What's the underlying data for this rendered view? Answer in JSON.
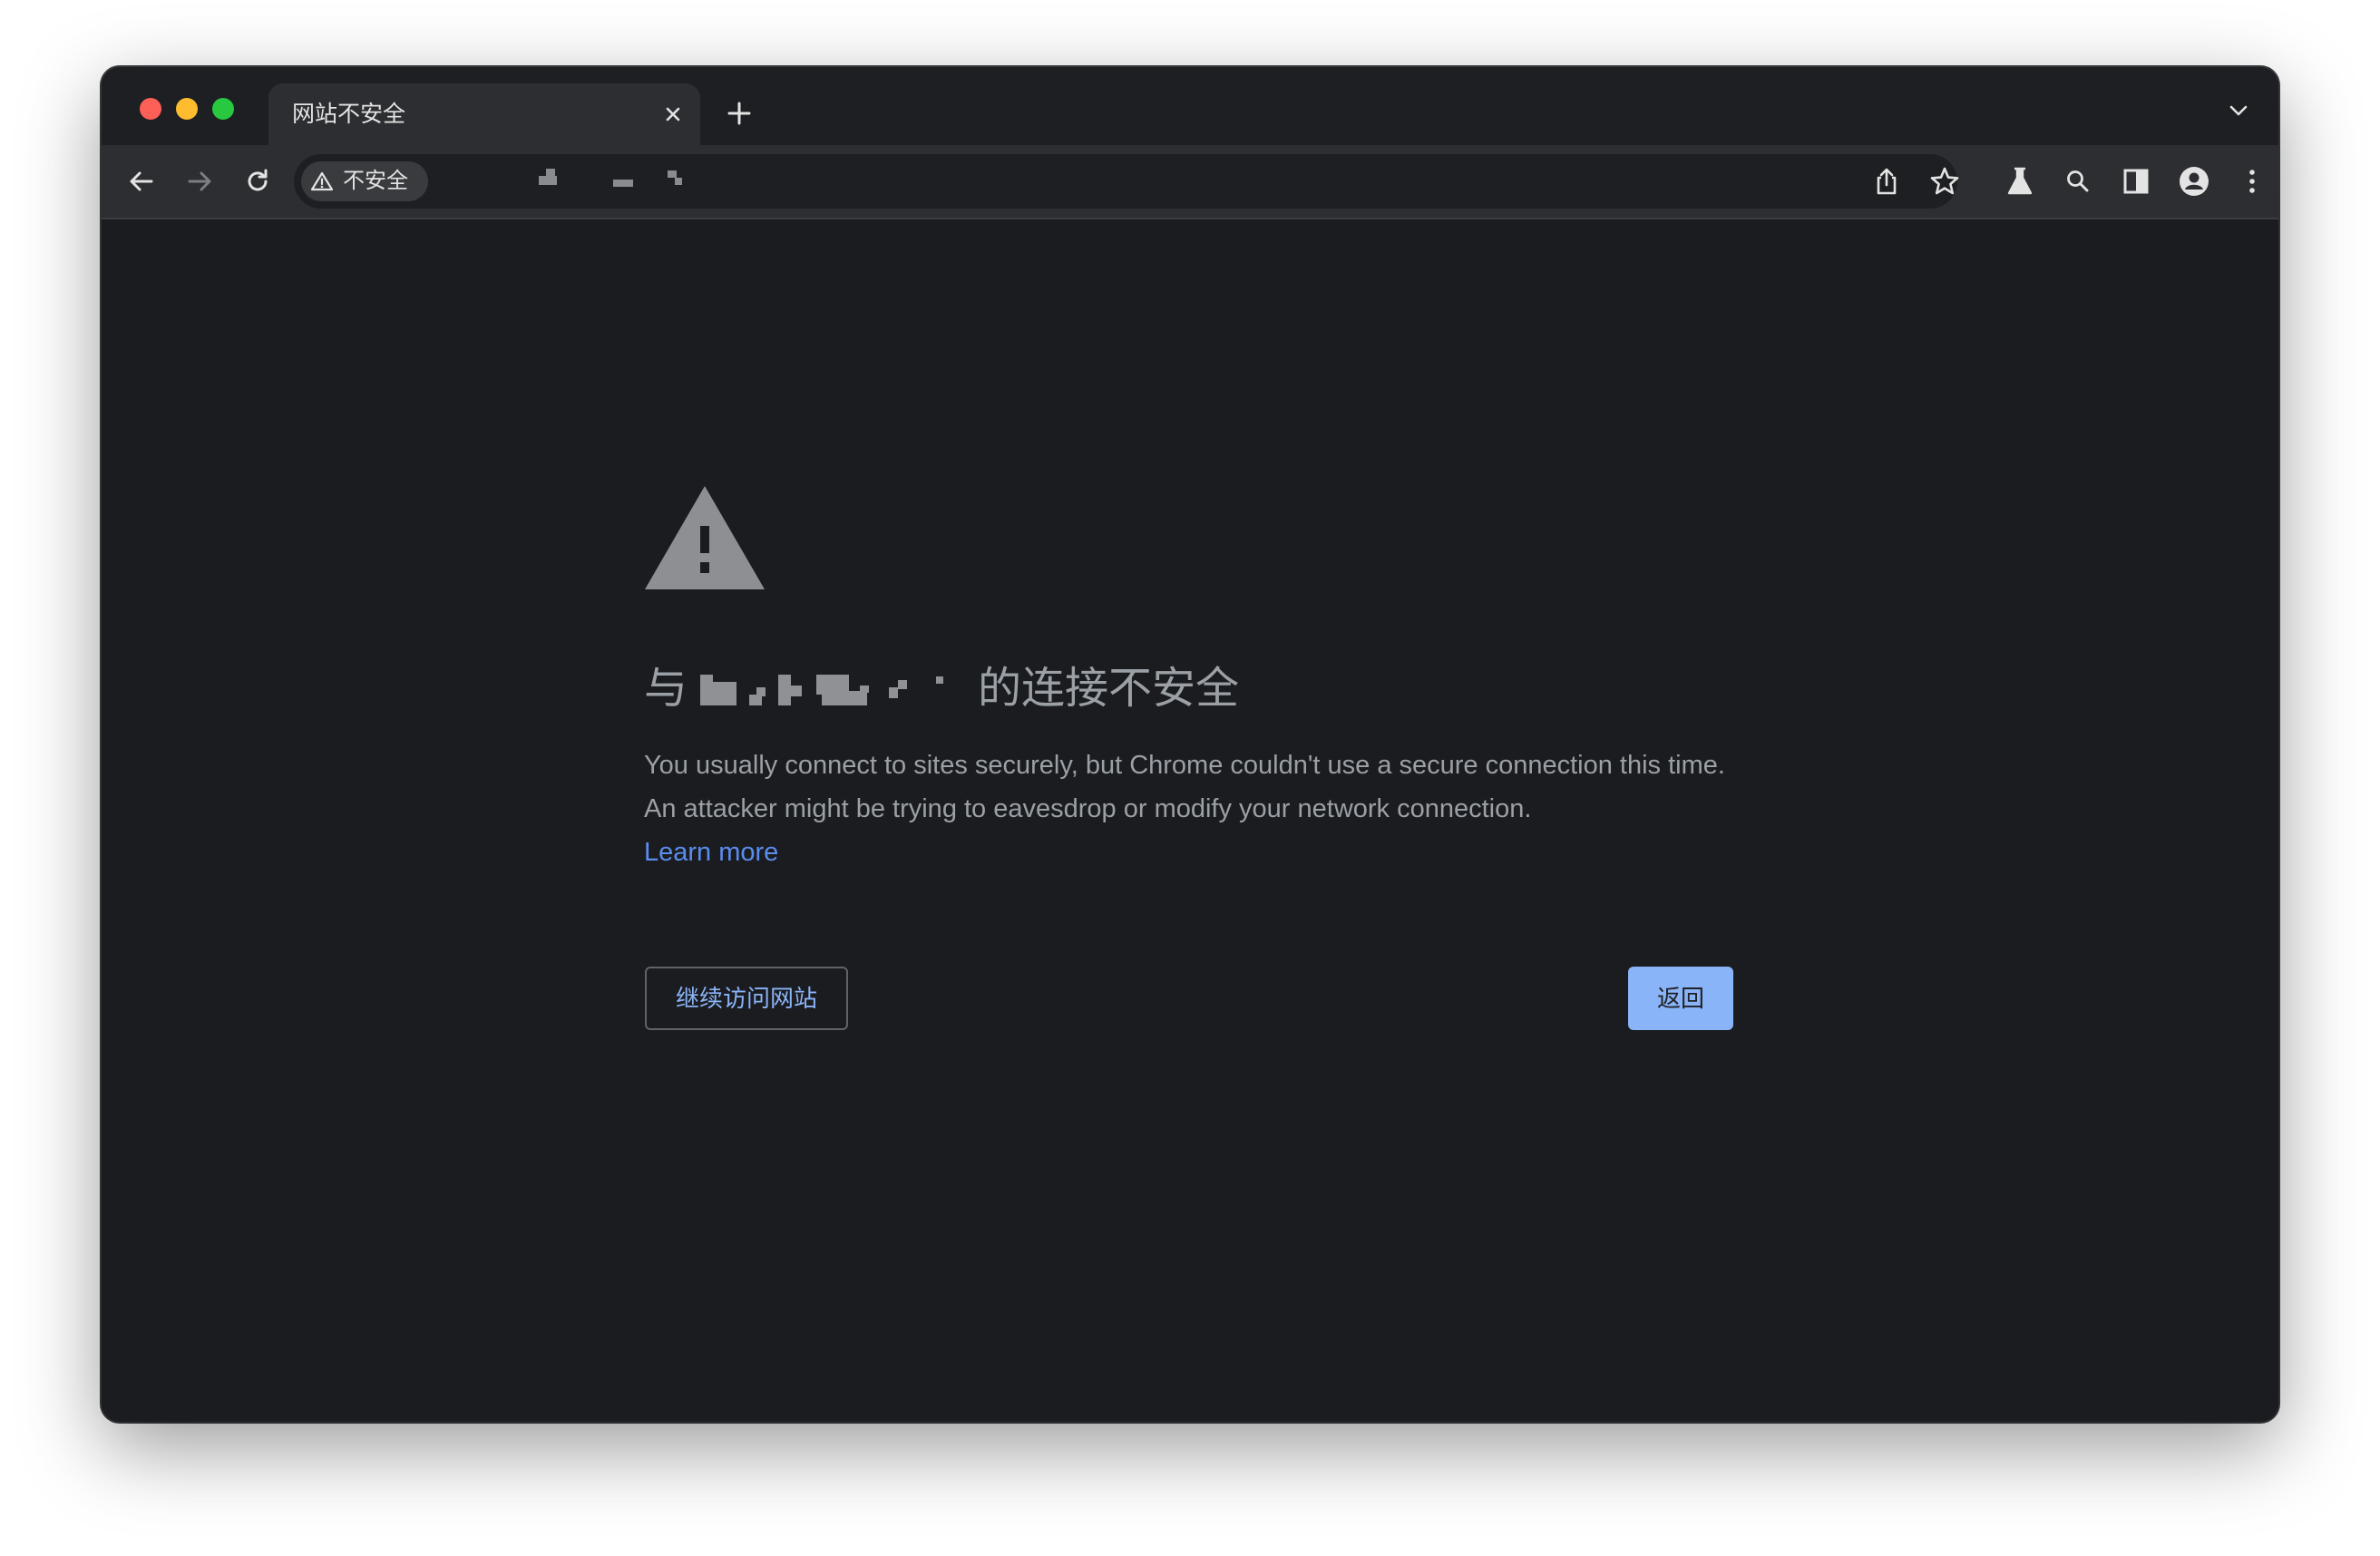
{
  "tab": {
    "title": "网站不安全",
    "close_icon": "close-icon",
    "new_tab_icon": "plus-icon"
  },
  "tab_list_icon": "chevron-down-icon",
  "toolbar": {
    "back_icon": "arrow-left-icon",
    "forward_icon": "arrow-right-icon",
    "reload_icon": "reload-icon",
    "security_chip": {
      "label": "不安全",
      "icon": "warning-icon"
    },
    "share_icon": "share-icon",
    "bookmark_icon": "star-icon",
    "labs_icon": "flask-icon",
    "search_icon": "search-icon",
    "side_panel_icon": "side-panel-icon",
    "profile_icon": "profile-icon",
    "menu_icon": "menu-dots-icon"
  },
  "interstitial": {
    "icon": "warning-triangle-icon",
    "heading_prefix": "与",
    "heading_suffix": "的连接不安全",
    "body": "You usually connect to sites securely, but Chrome couldn't use a secure connection this time. An attacker might be trying to eavesdrop or modify your network connection.",
    "learn_more": "Learn more",
    "proceed_button": "继续访问网站",
    "back_button": "返回"
  },
  "colors": {
    "background": "#1b1c1f",
    "toolbar": "#2d2e31",
    "text_secondary": "#9aa0a6",
    "link": "#5b8def",
    "primary_button": "#8ab4f8",
    "traffic_red": "#fe5f57",
    "traffic_yellow": "#febc2e",
    "traffic_green": "#28c840"
  }
}
